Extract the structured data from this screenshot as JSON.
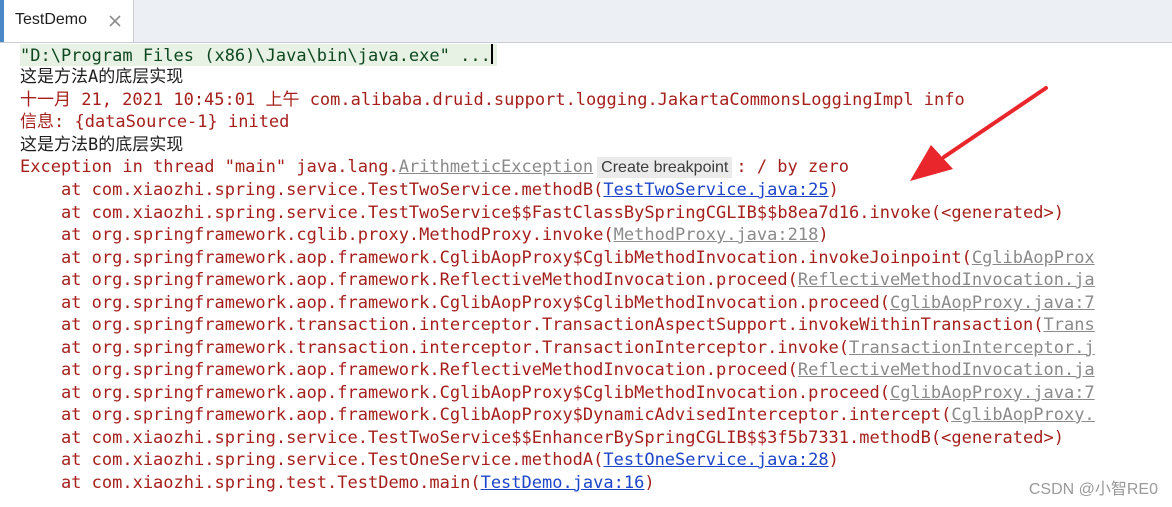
{
  "tab": {
    "label": "TestDemo",
    "close_icon": "close-icon"
  },
  "console": {
    "command": "\"D:\\Program Files (x86)\\Java\\bin\\java.exe\" ...",
    "out_a": "这是方法A的底层实现",
    "log_line": "十一月 21, 2021 10:45:01 上午 com.alibaba.druid.support.logging.JakartaCommonsLoggingImpl info",
    "info_line": "信息: {dataSource-1} inited",
    "out_b": "这是方法B的底层实现",
    "exception": {
      "prefix": "Exception in thread \"main\" java.lang.",
      "class_link": "ArithmeticException",
      "breakpoint_hint": "Create breakpoint",
      "message": ": / by zero"
    },
    "stack": [
      {
        "prefix": "    at com.xiaozhi.spring.service.TestTwoService.methodB(",
        "link": "TestTwoService.java:25",
        "suffix": ")",
        "kind": "link"
      },
      {
        "prefix": "    at com.xiaozhi.spring.service.TestTwoService$$FastClassBySpringCGLIB$$b8ea7d16.invoke(<generated>)",
        "link": "",
        "suffix": "",
        "kind": "none"
      },
      {
        "prefix": "    at org.springframework.cglib.proxy.MethodProxy.invoke(",
        "link": "MethodProxy.java:218",
        "suffix": ")",
        "kind": "gen"
      },
      {
        "prefix": "    at org.springframework.aop.framework.CglibAopProxy$CglibMethodInvocation.invokeJoinpoint(",
        "link": "CglibAopProx",
        "suffix": "",
        "kind": "gen"
      },
      {
        "prefix": "    at org.springframework.aop.framework.ReflectiveMethodInvocation.proceed(",
        "link": "ReflectiveMethodInvocation.ja",
        "suffix": "",
        "kind": "gen"
      },
      {
        "prefix": "    at org.springframework.aop.framework.CglibAopProxy$CglibMethodInvocation.proceed(",
        "link": "CglibAopProxy.java:7",
        "suffix": "",
        "kind": "gen"
      },
      {
        "prefix": "    at org.springframework.transaction.interceptor.TransactionAspectSupport.invokeWithinTransaction(",
        "link": "Trans",
        "suffix": "",
        "kind": "gen"
      },
      {
        "prefix": "    at org.springframework.transaction.interceptor.TransactionInterceptor.invoke(",
        "link": "TransactionInterceptor.j",
        "suffix": "",
        "kind": "gen"
      },
      {
        "prefix": "    at org.springframework.aop.framework.ReflectiveMethodInvocation.proceed(",
        "link": "ReflectiveMethodInvocation.ja",
        "suffix": "",
        "kind": "gen"
      },
      {
        "prefix": "    at org.springframework.aop.framework.CglibAopProxy$CglibMethodInvocation.proceed(",
        "link": "CglibAopProxy.java:7",
        "suffix": "",
        "kind": "gen"
      },
      {
        "prefix": "    at org.springframework.aop.framework.CglibAopProxy$DynamicAdvisedInterceptor.intercept(",
        "link": "CglibAopProxy.",
        "suffix": "",
        "kind": "gen"
      },
      {
        "prefix": "    at com.xiaozhi.spring.service.TestTwoService$$EnhancerBySpringCGLIB$$3f5b7331.methodB(<generated>)",
        "link": "",
        "suffix": "",
        "kind": "none"
      },
      {
        "prefix": "    at com.xiaozhi.spring.service.TestOneService.methodA(",
        "link": "TestOneService.java:28",
        "suffix": ")",
        "kind": "link"
      },
      {
        "prefix": "    at com.xiaozhi.spring.test.TestDemo.main(",
        "link": "TestDemo.java:16",
        "suffix": ")",
        "kind": "link"
      }
    ]
  },
  "colors": {
    "error_text": "#a5201c",
    "link": "#1c45c9",
    "annotation_arrow": "#e8262b"
  },
  "watermark": "CSDN @小智RE0"
}
